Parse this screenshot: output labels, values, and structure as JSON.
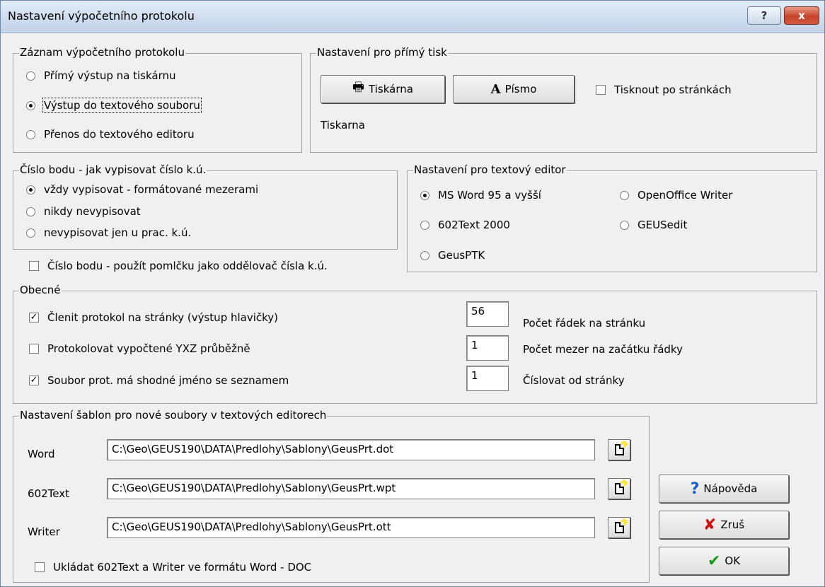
{
  "window": {
    "title": "Nastavení výpočetního protokolu",
    "help_glyph": "?",
    "close_glyph": "x"
  },
  "record": {
    "title": "Záznam výpočetního protokolu",
    "options": [
      "Přímý výstup na tiskárnu",
      "Výstup do textového souboru",
      "Přenos do textového editoru"
    ],
    "selected": "Výstup do textového souboru"
  },
  "print_settings": {
    "title": "Nastavení pro přímý tisk",
    "printer_button": "Tiskárna",
    "printer_icon": "printer-icon",
    "font_button": "Písmo",
    "font_icon_glyph": "A",
    "page_checkbox": "Tisknout po stránkách",
    "page_checked": false,
    "printer_name": "Tiskarna"
  },
  "point_number": {
    "title": "Číslo bodu - jak vypisovat číslo k.ú.",
    "options": [
      "vždy vypisovat - formátované mezerami",
      "nikdy nevypisovat",
      "nevypisovat jen u prac. k.ú."
    ],
    "selected": "vždy vypisovat - formátované mezerami",
    "dash_checkbox": "Číslo bodu - použít pomlčku jako oddělovač čísla k.ú.",
    "dash_checked": false
  },
  "editor": {
    "title": "Nastavení pro textový editor",
    "options": [
      "MS Word 95 a vyšší",
      "OpenOffice Writer",
      "602Text 2000",
      "GEUSedit",
      "GeusPTK"
    ],
    "selected": "MS Word 95 a vyšší"
  },
  "general": {
    "title": "Obecné",
    "checkboxes": [
      {
        "label": "Členit protokol na stránky (výstup hlavičky)",
        "checked": true
      },
      {
        "label": "Protokolovat vypočtené YXZ průběžně",
        "checked": false
      },
      {
        "label": "Soubor prot. má shodné jméno se seznamem",
        "checked": true
      }
    ],
    "fields": [
      {
        "value": "56",
        "label": "Počet řádek na stránku"
      },
      {
        "value": "1",
        "label": "Počet mezer na začátku řádky"
      },
      {
        "value": "1",
        "label": "Číslovat od stránky"
      }
    ]
  },
  "templates": {
    "title": "Nastavení šablon pro nové soubory v textových  editorech",
    "rows": [
      {
        "label": "Word",
        "path": "C:\\Geo\\GEUS190\\DATA\\Predlohy\\Sablony\\GeusPrt.dot"
      },
      {
        "label": "602Text",
        "path": "C:\\Geo\\GEUS190\\DATA\\Predlohy\\Sablony\\GeusPrt.wpt"
      },
      {
        "label": "Writer",
        "path": "C:\\Geo\\GEUS190\\DATA\\Predlohy\\Sablony\\GeusPrt.ott"
      }
    ],
    "doc_checkbox": "Ukládat 602Text a Writer ve formátu Word - DOC",
    "doc_checked": false
  },
  "buttons": {
    "help": "Nápověda",
    "cancel": "Zruš",
    "ok": "OK",
    "help_color": "#1a5fd0",
    "cancel_color": "#d01010",
    "ok_color": "#1a9a1a"
  }
}
